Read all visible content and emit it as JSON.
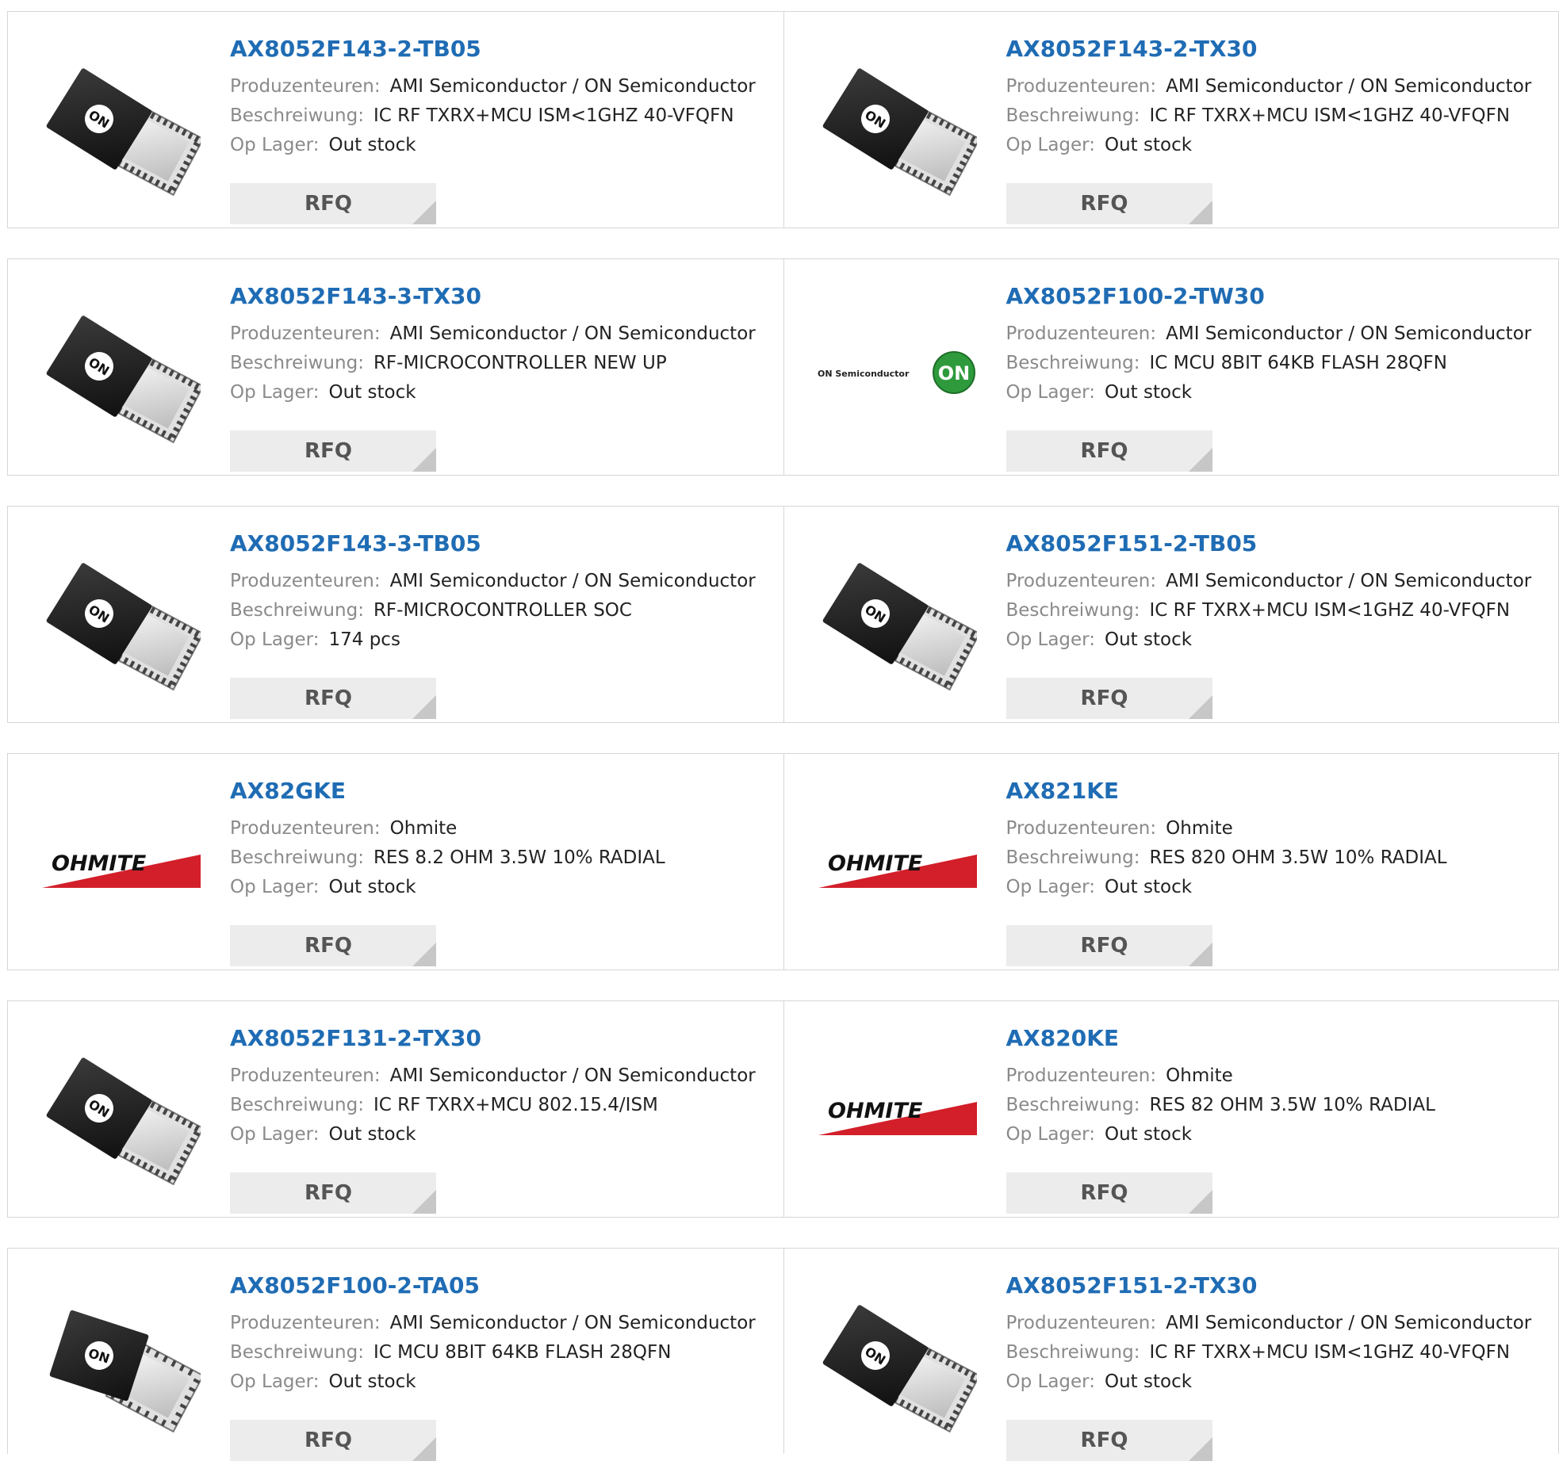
{
  "labels": {
    "manufacturer": "Produzenteuren:",
    "description": "Beschreiwung:",
    "stock": "Op Lager:",
    "rfq": "RFQ"
  },
  "colors": {
    "link": "#1f6cb4",
    "ohmite_red": "#d21f2a",
    "on_green": "#2e9a3c"
  },
  "products": [
    {
      "part": "AX8052F143-2-TB05",
      "manufacturer": "AMI Semiconductor / ON Semiconductor",
      "description": "IC RF TXRX+MCU ISM<1GHZ 40-VFQFN",
      "stock": "Out stock",
      "image": "on-chip-qfn"
    },
    {
      "part": "AX8052F143-2-TX30",
      "manufacturer": "AMI Semiconductor / ON Semiconductor",
      "description": "IC RF TXRX+MCU ISM<1GHZ 40-VFQFN",
      "stock": "Out stock",
      "image": "on-chip-qfn"
    },
    {
      "part": "AX8052F143-3-TX30",
      "manufacturer": "AMI Semiconductor / ON Semiconductor",
      "description": "RF-MICROCONTROLLER NEW UP",
      "stock": "Out stock",
      "image": "on-chip-qfn"
    },
    {
      "part": "AX8052F100-2-TW30",
      "manufacturer": "AMI Semiconductor / ON Semiconductor",
      "description": "IC MCU 8BIT 64KB FLASH 28QFN",
      "stock": "Out stock",
      "image": "on-semiconductor-logo",
      "logo_text": "ON Semiconductor"
    },
    {
      "part": "AX8052F143-3-TB05",
      "manufacturer": "AMI Semiconductor / ON Semiconductor",
      "description": "RF-MICROCONTROLLER SOC",
      "stock": "174 pcs",
      "image": "on-chip-qfn"
    },
    {
      "part": "AX8052F151-2-TB05",
      "manufacturer": "AMI Semiconductor / ON Semiconductor",
      "description": "IC RF TXRX+MCU ISM<1GHZ 40-VFQFN",
      "stock": "Out stock",
      "image": "on-chip-qfn"
    },
    {
      "part": "AX82GKE",
      "manufacturer": "Ohmite",
      "description": "RES 8.2 OHM 3.5W 10% RADIAL",
      "stock": "Out stock",
      "image": "ohmite-logo",
      "logo_text": "OHMITE"
    },
    {
      "part": "AX821KE",
      "manufacturer": "Ohmite",
      "description": "RES 820 OHM 3.5W 10% RADIAL",
      "stock": "Out stock",
      "image": "ohmite-logo",
      "logo_text": "OHMITE"
    },
    {
      "part": "AX8052F131-2-TX30",
      "manufacturer": "AMI Semiconductor / ON Semiconductor",
      "description": "IC RF TXRX+MCU 802.15.4/ISM",
      "stock": "Out stock",
      "image": "on-chip-qfn"
    },
    {
      "part": "AX820KE",
      "manufacturer": "Ohmite",
      "description": "RES 82 OHM 3.5W 10% RADIAL",
      "stock": "Out stock",
      "image": "ohmite-logo",
      "logo_text": "OHMITE"
    },
    {
      "part": "AX8052F100-2-TA05",
      "manufacturer": "AMI Semiconductor / ON Semiconductor",
      "description": "IC MCU 8BIT 64KB FLASH 28QFN",
      "stock": "Out stock",
      "image": "on-chip-qfn-28"
    },
    {
      "part": "AX8052F151-2-TX30",
      "manufacturer": "AMI Semiconductor / ON Semiconductor",
      "description": "IC RF TXRX+MCU ISM<1GHZ 40-VFQFN",
      "stock": "Out stock",
      "image": "on-chip-qfn"
    }
  ]
}
